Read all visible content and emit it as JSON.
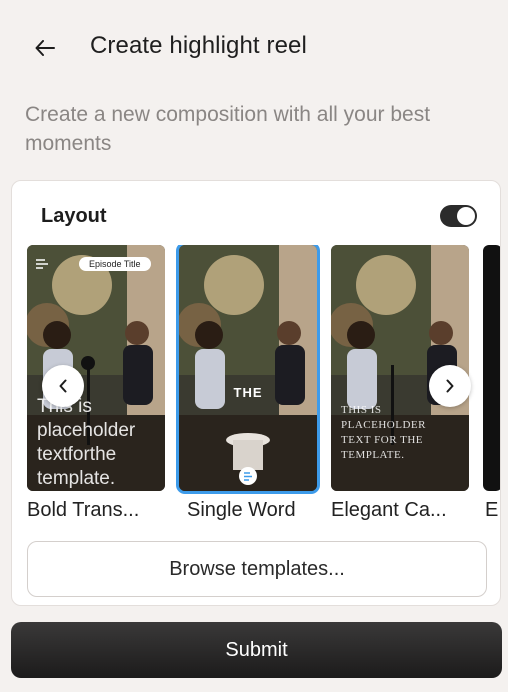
{
  "header": {
    "back_icon": "arrow-left-icon",
    "title": "Create highlight reel"
  },
  "subtitle": "Create a new composition with all your best moments",
  "layout": {
    "label": "Layout",
    "toggle_on": true,
    "templates": [
      {
        "label": "Bold Trans...",
        "pill": "Episode Title",
        "caption": "This is placeholder textforthe template.",
        "selected": false
      },
      {
        "label": "Single Word",
        "caption": "THE",
        "selected": true
      },
      {
        "label": "Elegant Ca...",
        "caption": "THIS IS PLACEHOLDER TEXT FOR THE TEMPLATE.",
        "selected": false
      },
      {
        "label": "E",
        "selected": false
      }
    ],
    "prev_icon": "chevron-left-icon",
    "next_icon": "chevron-right-icon"
  },
  "browse_label": "Browse templates...",
  "submit_label": "Submit",
  "colors": {
    "background": "#f4f1ef",
    "selected_outline": "#3d9bea",
    "submit_bg": "#1c1b1b"
  }
}
